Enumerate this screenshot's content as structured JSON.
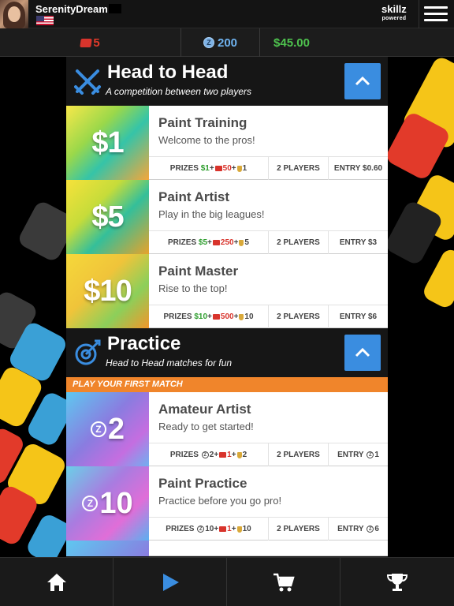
{
  "user": {
    "username": "SerenityDream"
  },
  "brand": {
    "name": "skillz",
    "tagline": "powered"
  },
  "currency": {
    "tickets": "5",
    "z_coins": "200",
    "cash": "$45.00"
  },
  "colors": {
    "accent_blue": "#3a8de0",
    "play_orange": "#f07f24",
    "banner_orange": "#f0852b",
    "cash_green": "#4ec24e",
    "zcoin_blue": "#7fb3e6"
  },
  "sections": [
    {
      "title": "Head to Head",
      "subtitle": "A competition between two players",
      "icon": "crossed-swords-icon",
      "games": [
        {
          "thumb": "$1",
          "title": "Paint Training",
          "desc": "Welcome to the pros!",
          "prize_cash": "$1",
          "prize_tickets": "50",
          "prize_trophies": "1",
          "players": "2 PLAYERS",
          "entry": "ENTRY $0.60"
        },
        {
          "thumb": "$5",
          "title": "Paint Artist",
          "desc": "Play in the big leagues!",
          "prize_cash": "$5",
          "prize_tickets": "250",
          "prize_trophies": "5",
          "players": "2 PLAYERS",
          "entry": "ENTRY $3"
        },
        {
          "thumb": "$10",
          "title": "Paint Master",
          "desc": "Rise to the top!",
          "prize_cash": "$10",
          "prize_tickets": "500",
          "prize_trophies": "10",
          "players": "2 PLAYERS",
          "entry": "ENTRY $6"
        }
      ]
    },
    {
      "title": "Practice",
      "subtitle": "Head to Head matches for fun",
      "icon": "target-icon",
      "banner": "PLAY YOUR FIRST MATCH",
      "games": [
        {
          "thumb": "2",
          "title": "Amateur Artist",
          "desc": "Ready to get started!",
          "prize_z": "2",
          "prize_tickets": "1",
          "prize_trophies": "2",
          "players": "2 PLAYERS",
          "entry_z": "1"
        },
        {
          "thumb": "10",
          "title": "Paint Practice",
          "desc": "Practice before you go pro!",
          "prize_z": "10",
          "prize_tickets": "1",
          "prize_trophies": "10",
          "players": "2 PLAYERS",
          "entry_z": "6"
        }
      ]
    }
  ],
  "labels": {
    "prizes": "PRIZES",
    "entry": "ENTRY",
    "plus": "+"
  },
  "nav": [
    "home-icon",
    "play-icon",
    "cart-icon",
    "trophy-icon"
  ]
}
